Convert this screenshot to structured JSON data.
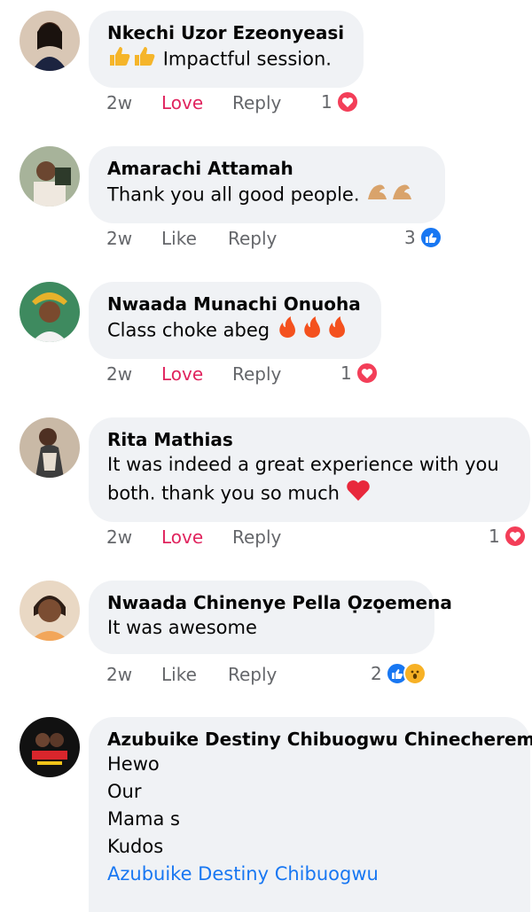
{
  "comments": [
    {
      "author": "Nkechi Uzor Ezeonyeasi",
      "text": "Impactful session.",
      "time": "2w",
      "reaction_label": "Love",
      "reply_label": "Reply",
      "reaction_count": "1",
      "reaction_icons": [
        "love-icon"
      ]
    },
    {
      "author": "Amarachi Attamah",
      "text": "Thank you all good people.",
      "time": "2w",
      "reaction_label": "Like",
      "reply_label": "Reply",
      "reaction_count": "3",
      "reaction_icons": [
        "like-icon"
      ]
    },
    {
      "author": "Nwaada Munachi Onuoha",
      "text": "Class choke abeg",
      "time": "2w",
      "reaction_label": "Love",
      "reply_label": "Reply",
      "reaction_count": "1",
      "reaction_icons": [
        "love-icon"
      ]
    },
    {
      "author": "Rita Mathias",
      "text_lines": [
        "It was indeed a great experience with you",
        "both. thank you so much"
      ],
      "time": "2w",
      "reaction_label": "Love",
      "reply_label": "Reply",
      "reaction_count": "1",
      "reaction_icons": [
        "love-icon"
      ]
    },
    {
      "author": "Nwaada Chinenye Pella Ọzọemena",
      "text": "It was awesome",
      "time": "2w",
      "reaction_label": "Like",
      "reply_label": "Reply",
      "reaction_count": "2",
      "reaction_icons": [
        "like-icon",
        "wow-icon"
      ]
    },
    {
      "author": "Azubuike Destiny Chibuogwu Chinecherem",
      "text_lines": [
        "Hewo",
        "Our",
        "Mama s",
        "Kudos"
      ],
      "mention": "Azubuike Destiny Chibuogwu"
    }
  ],
  "colors": {
    "bubble": "#f0f2f5",
    "love": "#f33e58",
    "like": "#1877f2",
    "muted": "#65676b"
  }
}
